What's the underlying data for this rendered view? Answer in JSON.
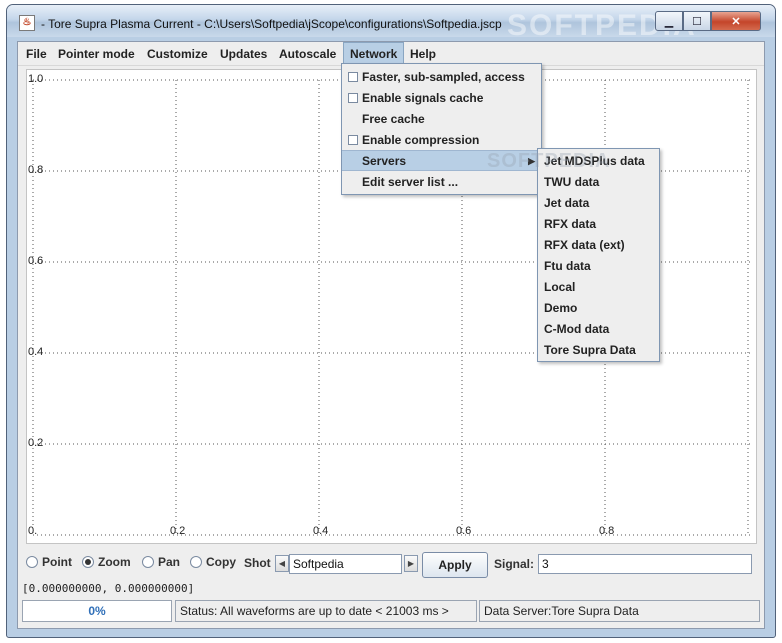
{
  "window": {
    "title": "- Tore Supra Plasma Current - C:\\Users\\Softpedia\\jScope\\configurations\\Softpedia.jscp",
    "app_icon": "java-cup-icon",
    "minimize_icon": "minimize-icon",
    "maximize_icon": "maximize-icon",
    "close_icon": "close-icon",
    "controls": {
      "minimize": "▁",
      "maximize": "☐",
      "close": "✕"
    }
  },
  "menubar": {
    "items": [
      "File",
      "Pointer mode",
      "Customize",
      "Updates",
      "Autoscale",
      "Network",
      "Help"
    ],
    "active": "Network"
  },
  "network_menu": {
    "items": [
      {
        "label": "Faster, sub-sampled, access",
        "checkbox": true
      },
      {
        "label": "Enable signals cache",
        "checkbox": true
      },
      {
        "label": "Free cache",
        "checkbox": false
      },
      {
        "label": "Enable compression",
        "checkbox": true
      },
      {
        "label": "Servers",
        "checkbox": false,
        "submenu": true,
        "arrow": "▶"
      },
      {
        "label": "Edit server list ...",
        "checkbox": false
      }
    ]
  },
  "servers_submenu": {
    "items": [
      "Jet MDSPlus data",
      "TWU data",
      "Jet data",
      "RFX data",
      "RFX data (ext)",
      "Ftu data",
      "Local",
      "Demo",
      "C-Mod data",
      "Tore Supra Data"
    ]
  },
  "watermark": "SOFTPEDIA",
  "plot": {
    "y_ticks": [
      "1.0",
      "0.8",
      "0.6",
      "0.4",
      "0.2",
      "0."
    ],
    "x_ticks": [
      "0.2",
      "0.4",
      "0.6",
      "0.8"
    ],
    "grid": "dotted",
    "xlim": [
      0,
      1
    ],
    "ylim": [
      0,
      1
    ]
  },
  "controls": {
    "pointer_modes": [
      {
        "label": "Point",
        "checked": false
      },
      {
        "label": "Zoom",
        "checked": true
      },
      {
        "label": "Pan",
        "checked": false
      },
      {
        "label": "Copy",
        "checked": false
      }
    ],
    "shot_label": "Shot",
    "shot_value": "Softpedia",
    "prev_arrow": "◀",
    "next_arrow": "▶",
    "apply_label": "Apply",
    "signal_label": "Signal:",
    "signal_value": "3"
  },
  "coordinates": "[0.000000000, 0.000000000]",
  "status": {
    "progress": "0%",
    "message": "Status: All waveforms are up to date < 21003 ms >",
    "data_server": "Data Server:Tore Supra Data"
  }
}
